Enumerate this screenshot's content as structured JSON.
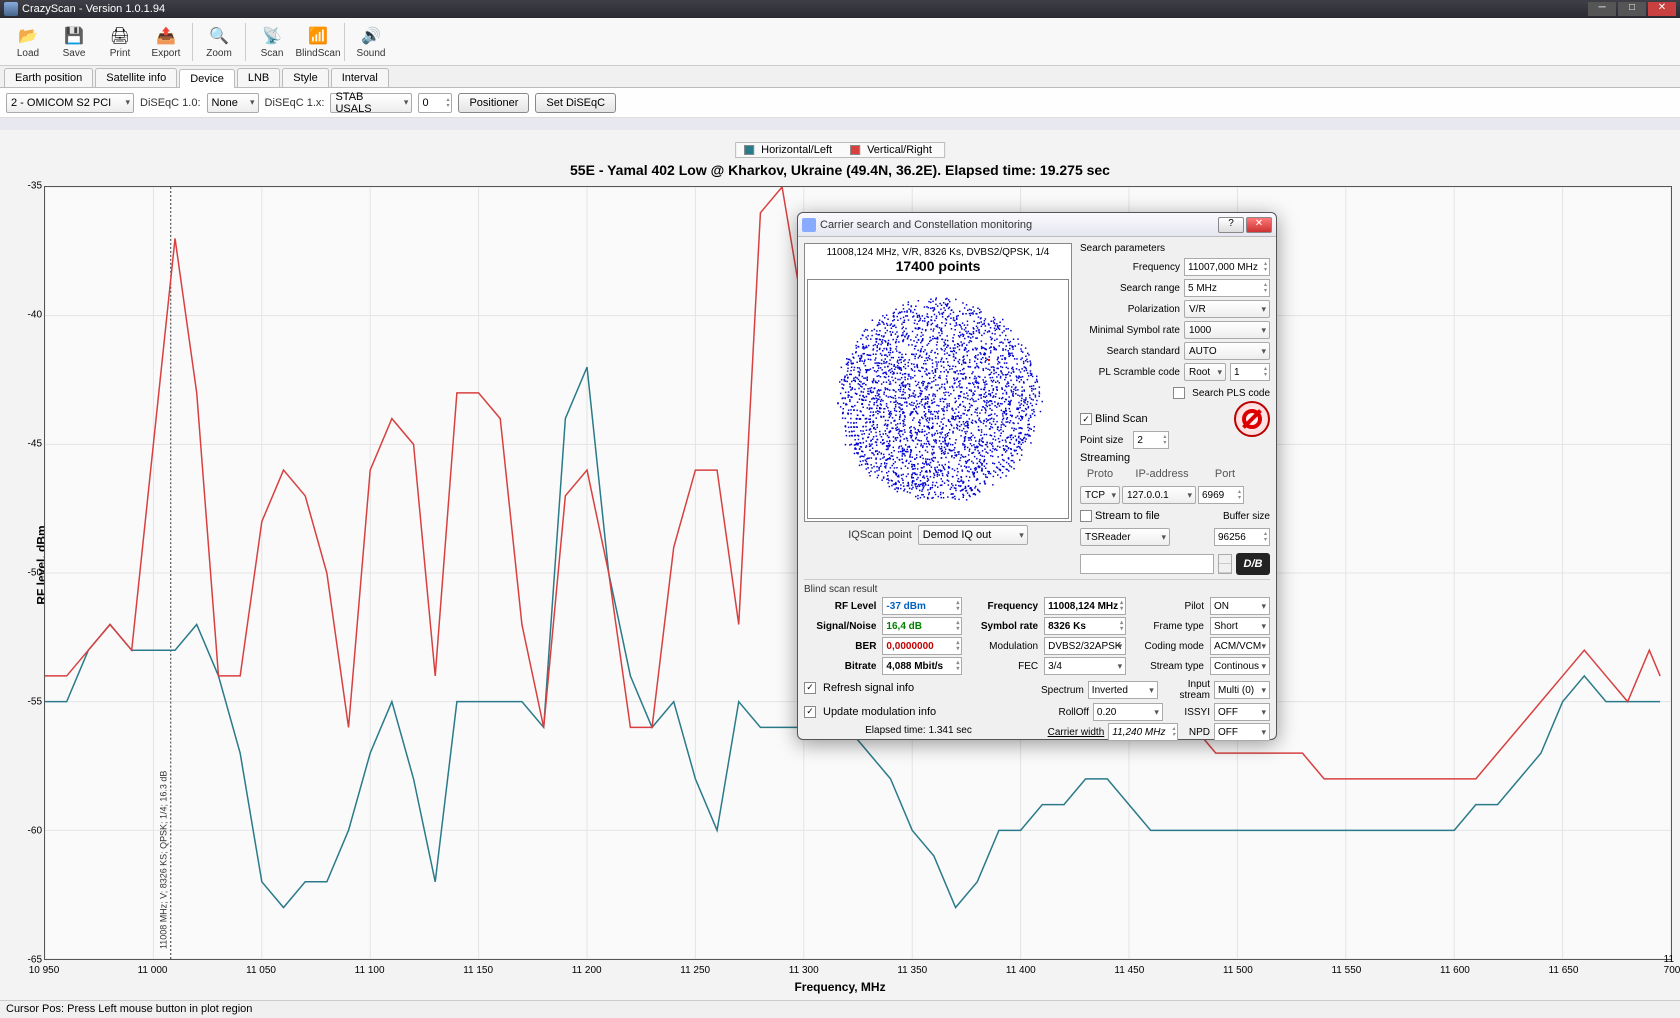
{
  "window": {
    "title": "CrazyScan - Version 1.0.1.94"
  },
  "toolbar": [
    {
      "id": "load",
      "label": "Load",
      "icon": "📂"
    },
    {
      "id": "save",
      "label": "Save",
      "icon": "💾"
    },
    {
      "id": "print",
      "label": "Print",
      "icon": "🖨"
    },
    {
      "id": "export",
      "label": "Export",
      "icon": "📤"
    },
    {
      "id": "",
      "label": "",
      "icon": ""
    },
    {
      "id": "zoom",
      "label": "Zoom",
      "icon": "🔍"
    },
    {
      "id": "",
      "label": "",
      "icon": ""
    },
    {
      "id": "scan",
      "label": "Scan",
      "icon": "📡"
    },
    {
      "id": "blindscan",
      "label": "BlindScan",
      "icon": "📶"
    },
    {
      "id": "",
      "label": "",
      "icon": ""
    },
    {
      "id": "sound",
      "label": "Sound",
      "icon": "🔊"
    }
  ],
  "tabs": [
    "Earth position",
    "Satellite info",
    "Device",
    "LNB",
    "Style",
    "Interval"
  ],
  "activeTab": 2,
  "device": {
    "selected": "2 - OMICOM S2 PCI",
    "diseqc10_lbl": "DiSEqC 1.0:",
    "diseqc10": "None",
    "diseqc1x_lbl": "DiSEqC 1.x:",
    "diseqc1x": "STAB USALS",
    "posnum": "0",
    "positioner_btn": "Positioner",
    "setdiseqc_btn": "Set DiSEqC"
  },
  "legend": {
    "h": "Horizontal/Left",
    "v": "Vertical/Right"
  },
  "chart": {
    "title": "55E - Yamal 402 Low @ Kharkov, Ukraine (49.4N, 36.2E). Elapsed time: 19.275 sec",
    "ylabel": "RF level, dBm",
    "xlabel": "Frequency, MHz",
    "cursor_text": "11008 MHz; V; 8326 KS; QPSK; 1/4; 16.3 dB"
  },
  "chart_data": {
    "type": "line",
    "xlabel": "Frequency, MHz",
    "ylabel": "RF level, dBm",
    "xlim": [
      10950,
      11700
    ],
    "ylim": [
      -65,
      -35
    ],
    "xticks": [
      10950,
      11000,
      11050,
      11100,
      11150,
      11200,
      11250,
      11300,
      11350,
      11400,
      11450,
      11500,
      11550,
      11600,
      11650,
      11700
    ],
    "yticks": [
      -65,
      -60,
      -55,
      -50,
      -45,
      -40,
      -35
    ],
    "cursor_x": 11008,
    "series": [
      {
        "name": "Horizontal/Left",
        "color": "#2a7a8a",
        "x": [
          10950,
          10960,
          10970,
          10980,
          10990,
          11000,
          11010,
          11020,
          11030,
          11040,
          11050,
          11060,
          11070,
          11080,
          11090,
          11100,
          11110,
          11120,
          11130,
          11140,
          11150,
          11160,
          11170,
          11180,
          11190,
          11200,
          11210,
          11220,
          11230,
          11240,
          11250,
          11260,
          11270,
          11280,
          11290,
          11300,
          11310,
          11320,
          11330,
          11340,
          11350,
          11360,
          11370,
          11380,
          11390,
          11400,
          11410,
          11420,
          11430,
          11440,
          11450,
          11460,
          11470,
          11480,
          11490,
          11500,
          11510,
          11520,
          11530,
          11540,
          11550,
          11560,
          11570,
          11580,
          11590,
          11600,
          11610,
          11620,
          11630,
          11640,
          11650,
          11660,
          11670,
          11680,
          11690,
          11695
        ],
        "y": [
          -55,
          -55,
          -53,
          -52,
          -53,
          -53,
          -53,
          -52,
          -54,
          -57,
          -62,
          -63,
          -62,
          -62,
          -60,
          -57,
          -55,
          -58,
          -62,
          -55,
          -55,
          -55,
          -55,
          -56,
          -44,
          -42,
          -50,
          -54,
          -56,
          -55,
          -58,
          -60,
          -55,
          -56,
          -56,
          -56,
          -56,
          -56,
          -57,
          -58,
          -60,
          -61,
          -63,
          -62,
          -60,
          -60,
          -59,
          -59,
          -58,
          -58,
          -59,
          -60,
          -60,
          -60,
          -60,
          -60,
          -60,
          -60,
          -60,
          -60,
          -60,
          -60,
          -60,
          -60,
          -60,
          -60,
          -59,
          -59,
          -58,
          -57,
          -55,
          -54,
          -55,
          -55,
          -55,
          -55
        ]
      },
      {
        "name": "Vertical/Right",
        "color": "#d84040",
        "x": [
          10950,
          10960,
          10970,
          10980,
          10990,
          11000,
          11010,
          11020,
          11030,
          11040,
          11050,
          11060,
          11070,
          11080,
          11090,
          11100,
          11110,
          11120,
          11130,
          11140,
          11150,
          11160,
          11170,
          11180,
          11190,
          11200,
          11210,
          11220,
          11230,
          11240,
          11250,
          11260,
          11270,
          11280,
          11290,
          11300,
          11310,
          11320,
          11330,
          11340,
          11350,
          11360,
          11370,
          11380,
          11390,
          11400,
          11410,
          11420,
          11430,
          11440,
          11450,
          11460,
          11470,
          11480,
          11490,
          11500,
          11510,
          11520,
          11530,
          11540,
          11550,
          11560,
          11570,
          11580,
          11590,
          11600,
          11610,
          11620,
          11630,
          11640,
          11650,
          11660,
          11670,
          11680,
          11690,
          11695
        ],
        "y": [
          -54,
          -54,
          -53,
          -52,
          -53,
          -45,
          -37,
          -43,
          -54,
          -54,
          -48,
          -46,
          -47,
          -50,
          -56,
          -46,
          -44,
          -45,
          -54,
          -43,
          -43,
          -44,
          -52,
          -56,
          -47,
          -46,
          -50,
          -56,
          -56,
          -49,
          -46,
          -46,
          -52,
          -36,
          -35,
          -40,
          -53,
          -44,
          -42,
          -42,
          -46,
          -55,
          -56,
          -56,
          -56,
          -56,
          -56,
          -56,
          -56,
          -56,
          -56,
          -56,
          -56,
          -56,
          -57,
          -57,
          -57,
          -57,
          -57,
          -58,
          -58,
          -58,
          -58,
          -58,
          -58,
          -58,
          -58,
          -57,
          -56,
          -55,
          -54,
          -53,
          -54,
          -55,
          -53,
          -54
        ]
      }
    ]
  },
  "statusbar": "Cursor Pos: Press Left mouse button in plot region",
  "dialog": {
    "title": "Carrier search and Constellation monitoring",
    "constel": {
      "info": "11008,124 MHz, V/R, 8326 Ks, DVBS2/QPSK, 1/4",
      "points": "17400 points"
    },
    "iqscan_lbl": "IQScan point",
    "iqscan": "Demod IQ out",
    "params_title": "Search parameters",
    "params": {
      "frequency_lbl": "Frequency",
      "frequency": "11007,000 MHz",
      "range_lbl": "Search range",
      "range": "5 MHz",
      "pol_lbl": "Polarization",
      "pol": "V/R",
      "minsr_lbl": "Minimal Symbol rate",
      "minsr": "1000",
      "std_lbl": "Search standard",
      "std": "AUTO",
      "pls_lbl": "PL Scramble code",
      "pls_mode": "Root",
      "pls_val": "1",
      "searchpls_lbl": "Search PLS code",
      "searchpls": false,
      "blindscan_lbl": "Blind Scan",
      "blindscan": true,
      "pointsize_lbl": "Point size",
      "pointsize": "2"
    },
    "streaming": {
      "title": "Streaming",
      "proto_lbl": "Proto",
      "proto": "TCP",
      "ip_lbl": "IP-address",
      "ip": "127.0.0.1",
      "port_lbl": "Port",
      "port": "6969",
      "stream_lbl": "Stream to file",
      "stream": false,
      "reader": "TSReader",
      "bufsize_lbl": "Buffer size",
      "bufsize": "96256"
    },
    "results": {
      "title": "Blind scan result",
      "rflevel_lbl": "RF Level",
      "rflevel": "-37 dBm",
      "freq_lbl": "Frequency",
      "freq": "11008,124 MHz",
      "pilot_lbl": "Pilot",
      "pilot": "ON",
      "sn_lbl": "Signal/Noise",
      "sn": "16,4 dB",
      "sr_lbl": "Symbol rate",
      "sr": "8326 Ks",
      "frametype_lbl": "Frame type",
      "frametype": "Short",
      "ber_lbl": "BER",
      "ber": "0,0000000",
      "mod_lbl": "Modulation",
      "mod": "DVBS2/32APSK",
      "codmode_lbl": "Coding mode",
      "codmode": "ACM/VCM",
      "bitrate_lbl": "Bitrate",
      "bitrate": "4,088 Mbit/s",
      "fec_lbl": "FEC",
      "fec": "3/4",
      "streamtype_lbl": "Stream type",
      "streamtype": "Continous",
      "refresh_lbl": "Refresh signal info",
      "refresh": true,
      "spectrum_lbl": "Spectrum",
      "spectrum": "Inverted",
      "inputstream_lbl": "Input stream",
      "inputstream": "Multi (0)",
      "updmod_lbl": "Update modulation info",
      "updmod": true,
      "rolloff_lbl": "RollOff",
      "rolloff": "0.20",
      "issyi_lbl": "ISSYI",
      "issyi": "OFF",
      "elapsed_lbl": "Elapsed time: 1.341 sec",
      "carrierw_lbl": "Carrier width",
      "carrierw": "11,240 MHz",
      "npd_lbl": "NPD",
      "npd": "OFF"
    }
  }
}
